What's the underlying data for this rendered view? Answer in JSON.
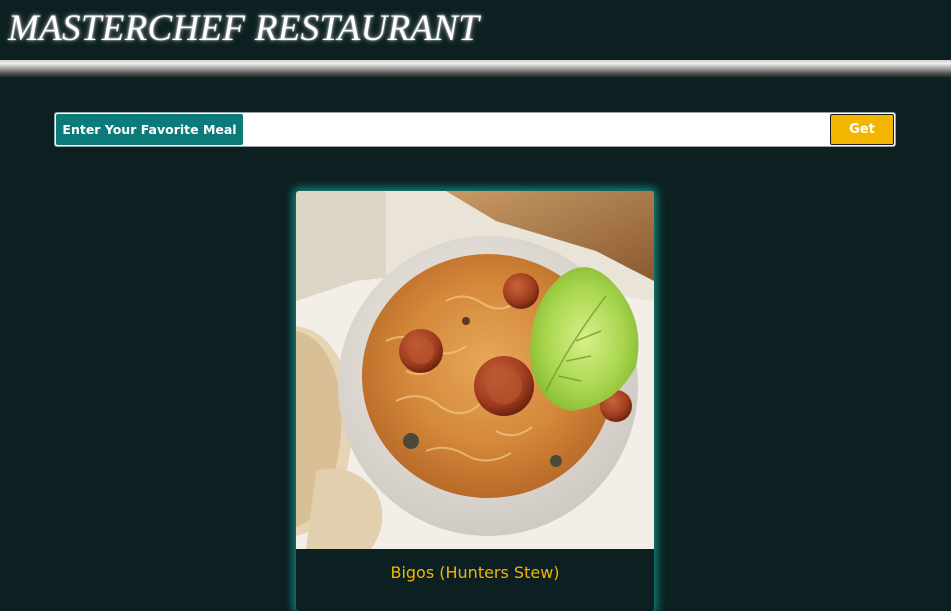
{
  "header": {
    "title": "MASTERCHEF RESTAURANT"
  },
  "search": {
    "label": "Enter Your Favorite Meal",
    "value": "",
    "placeholder": "",
    "button_label": "Get"
  },
  "meals": [
    {
      "name": "Bigos (Hunters Stew)",
      "image": "bigos-hunters-stew-photo"
    }
  ],
  "colors": {
    "background": "#0c2021",
    "accent_teal": "#0b7b7a",
    "accent_gold": "#f4b500",
    "card_glow": "#16aaa0"
  }
}
